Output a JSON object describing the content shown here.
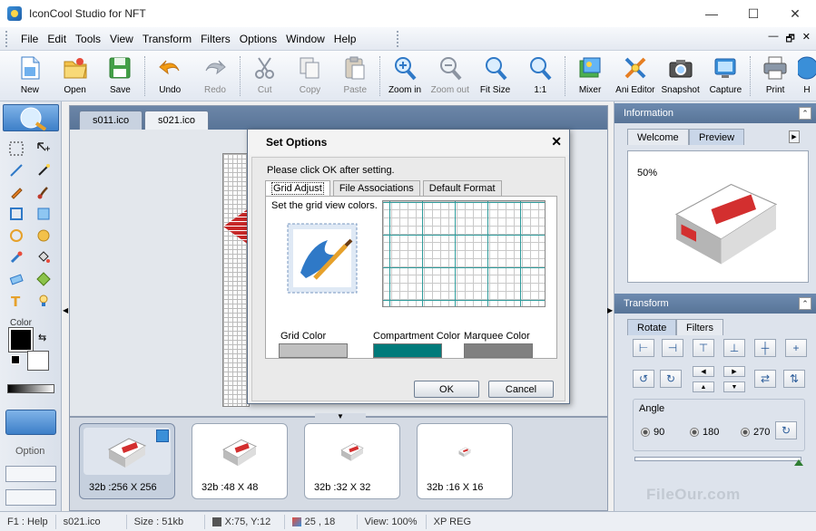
{
  "window": {
    "title": "IconCool Studio for NFT",
    "controls": [
      "—",
      "☐",
      "✕"
    ]
  },
  "menu": [
    "File",
    "Edit",
    "Tools",
    "View",
    "Transform",
    "Filters",
    "Options",
    "Window",
    "Help"
  ],
  "mdi_controls": [
    "—",
    "🗗",
    "✕"
  ],
  "toolbar": [
    {
      "label": "New",
      "icon": "new-file-icon"
    },
    {
      "label": "Open",
      "icon": "open-folder-icon"
    },
    {
      "label": "Save",
      "icon": "save-icon"
    },
    {
      "label": "Undo",
      "icon": "undo-icon"
    },
    {
      "label": "Redo",
      "icon": "redo-icon"
    },
    {
      "label": "Cut",
      "icon": "cut-icon"
    },
    {
      "label": "Copy",
      "icon": "copy-icon"
    },
    {
      "label": "Paste",
      "icon": "paste-icon"
    },
    {
      "label": "Zoom in",
      "icon": "zoom-in-icon"
    },
    {
      "label": "Zoom out",
      "icon": "zoom-out-icon"
    },
    {
      "label": "Fit Size",
      "icon": "fit-size-icon"
    },
    {
      "label": "1:1",
      "icon": "actual-size-icon"
    },
    {
      "label": "Mixer",
      "icon": "mixer-icon"
    },
    {
      "label": "Ani Editor",
      "icon": "ani-editor-icon"
    },
    {
      "label": "Snapshot",
      "icon": "camera-icon"
    },
    {
      "label": "Capture",
      "icon": "capture-icon"
    },
    {
      "label": "Print",
      "icon": "printer-icon"
    },
    {
      "label": "H",
      "icon": "help-icon"
    }
  ],
  "left_panel": {
    "color_label": "Color",
    "option_label": "Option"
  },
  "doc_tabs": [
    "s011.ico",
    "s021.ico"
  ],
  "dialog": {
    "title": "Set Options",
    "instruction": "Please click OK after setting.",
    "tabs": [
      "Grid Adjust",
      "File Associations",
      "Default Format"
    ],
    "grid_text": "Set the grid view colors.",
    "colors": [
      {
        "label": "Grid Color",
        "value": "#c0c0c0"
      },
      {
        "label": "Compartment Color",
        "value": "#007a7a"
      },
      {
        "label": "Marquee Color",
        "value": "#808080"
      }
    ],
    "ok": "OK",
    "cancel": "Cancel"
  },
  "thumbnails": [
    {
      "caption": "32b :256 X 256",
      "selected": true
    },
    {
      "caption": "32b :48 X 48",
      "selected": false
    },
    {
      "caption": "32b :32 X 32",
      "selected": false
    },
    {
      "caption": "32b :16 X 16",
      "selected": false
    }
  ],
  "information": {
    "header": "Information",
    "tabs": [
      "Welcome",
      "Preview"
    ],
    "zoom": "50%"
  },
  "transform": {
    "header": "Transform",
    "tabs": [
      "Rotate",
      "Filters"
    ],
    "angle_label": "Angle",
    "angles": [
      "90",
      "180",
      "270"
    ]
  },
  "status": {
    "help": "F1 : Help",
    "file": "s021.ico",
    "size": "Size : 51kb",
    "pos": "X:75, Y:12",
    "coord": "25 , 18",
    "view": "View: 100%",
    "theme": "XP REG"
  },
  "watermark": "FileOur.com",
  "colors": {
    "accent": "#587497",
    "compartment": "#007a7a"
  }
}
